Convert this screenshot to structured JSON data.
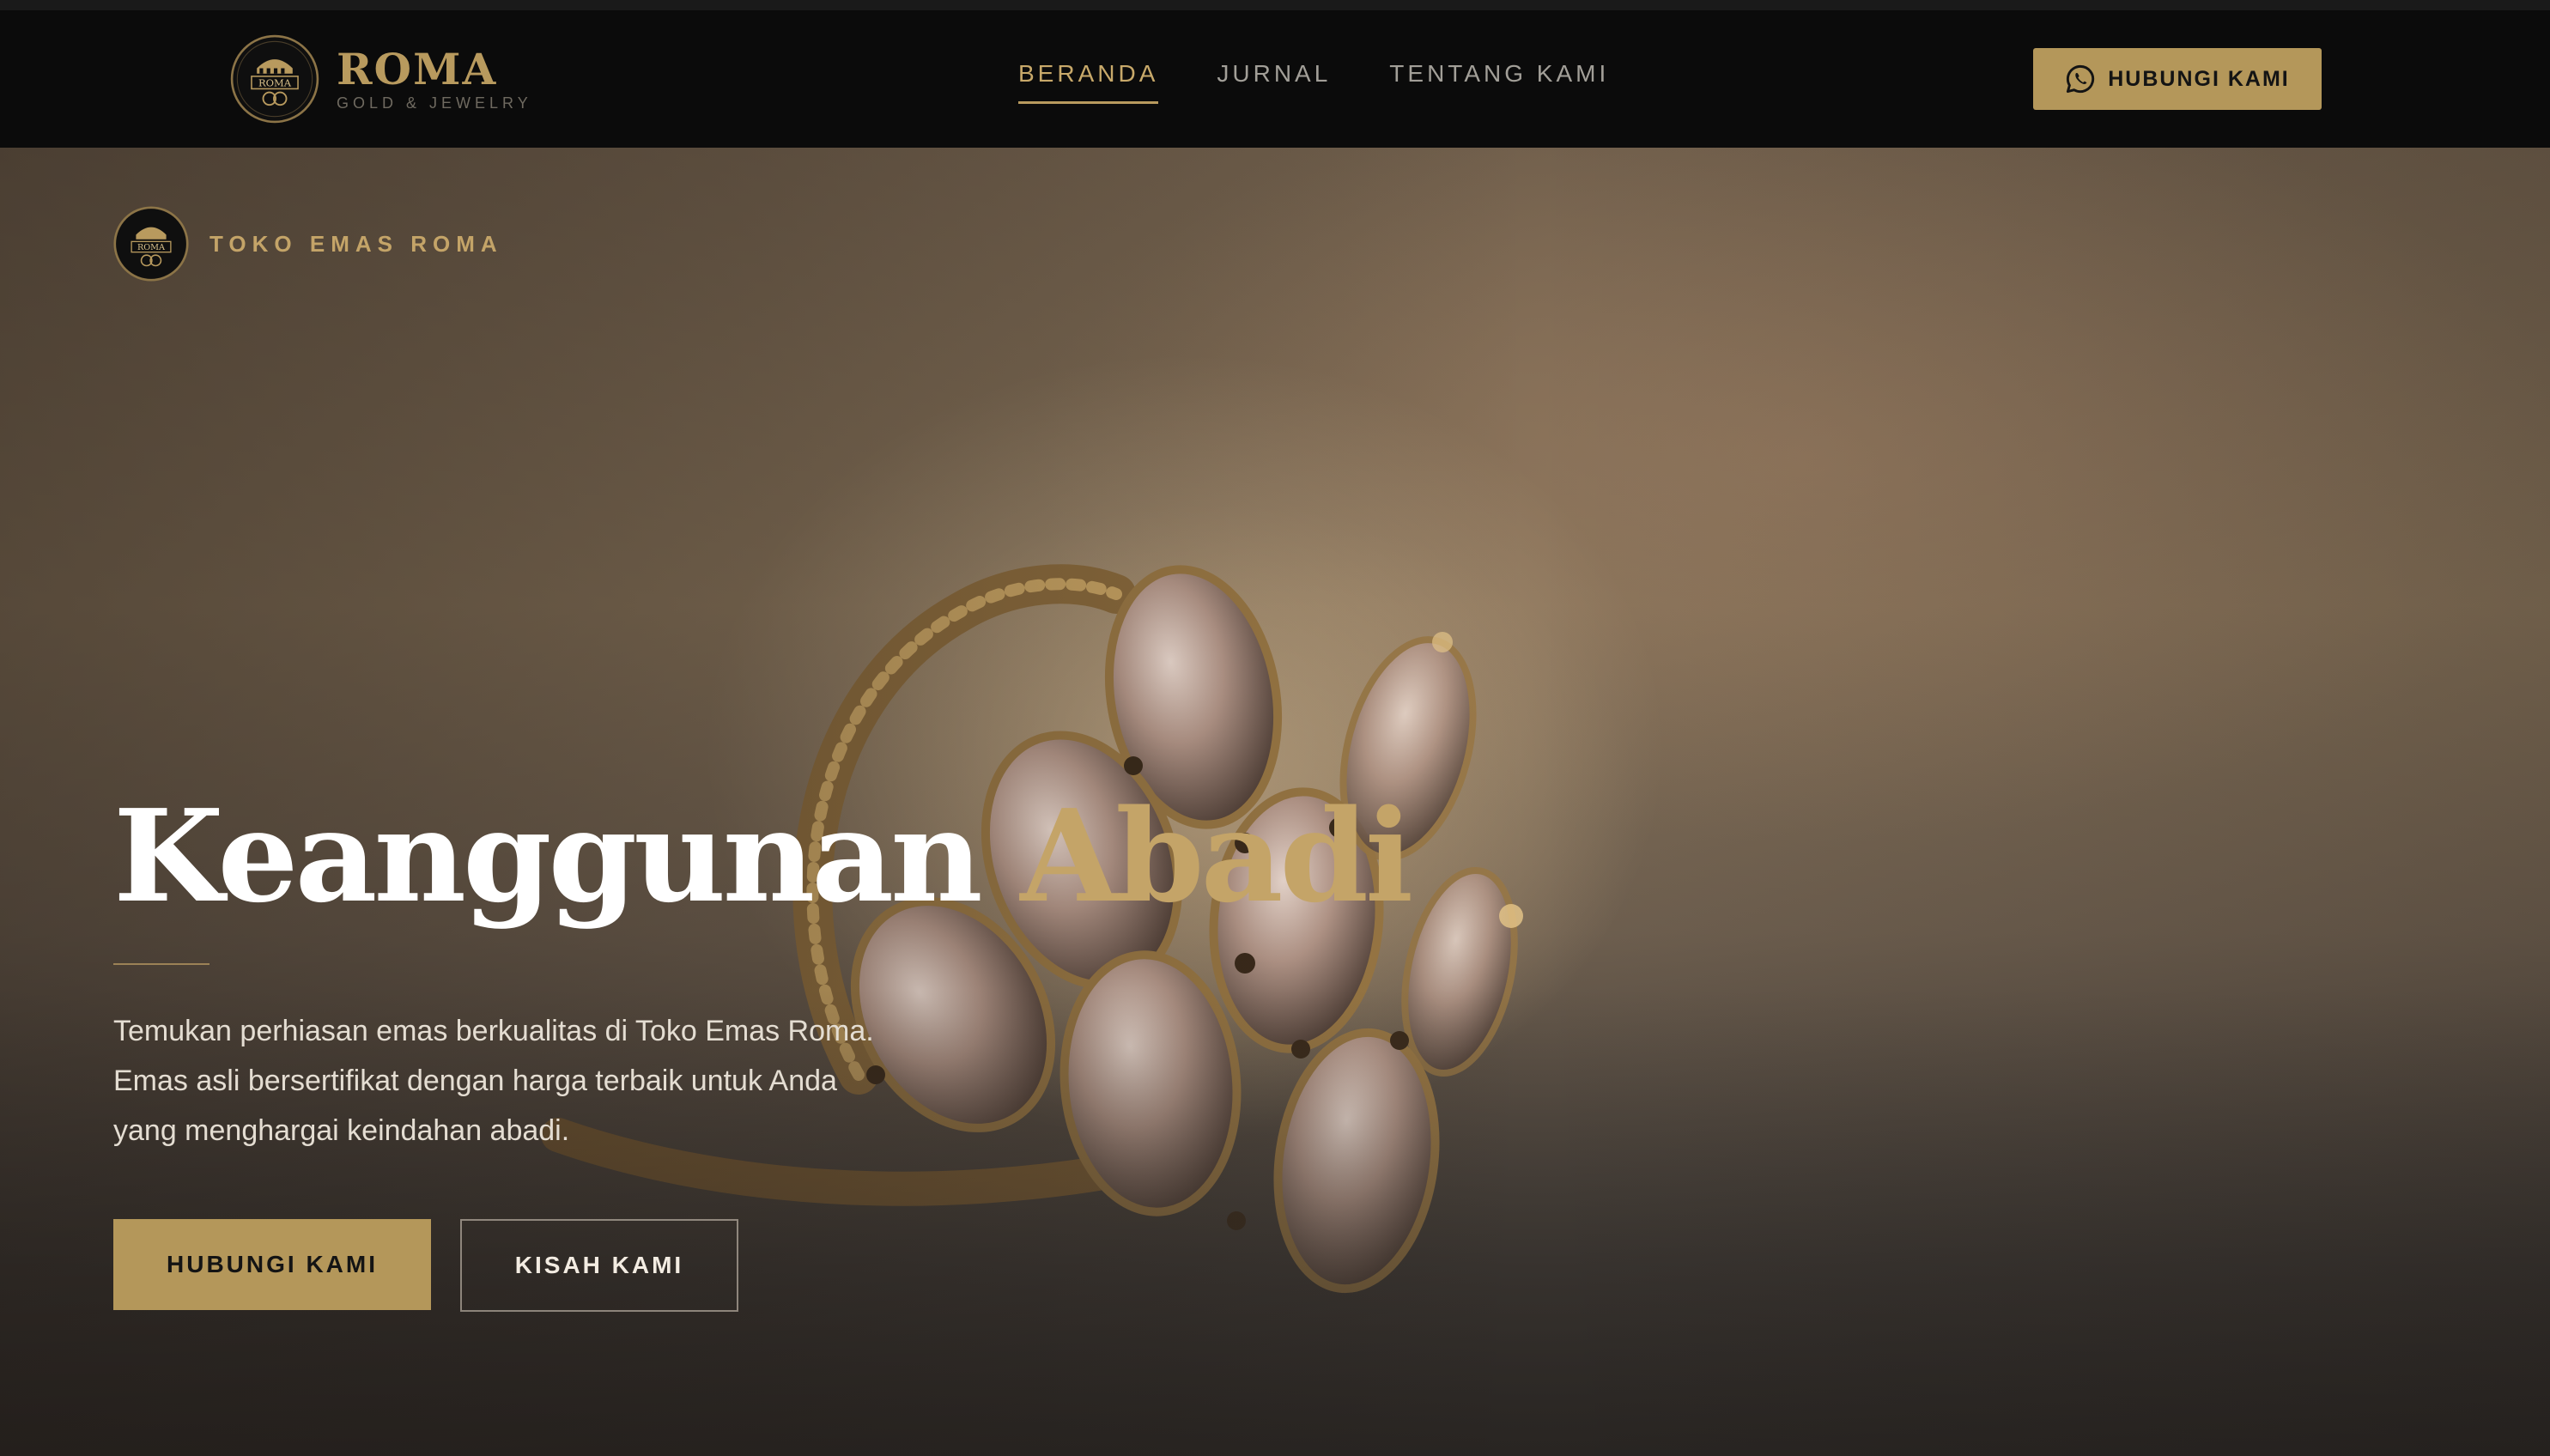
{
  "header": {
    "brand": {
      "name": "ROMA",
      "tagline": "GOLD & JEWELRY",
      "seal_text": "ROMA"
    },
    "nav": [
      {
        "label": "BERANDA",
        "active": true
      },
      {
        "label": "JURNAL",
        "active": false
      },
      {
        "label": "TENTANG KAMI",
        "active": false
      }
    ],
    "cta": {
      "label": "HUBUNGI KAMI",
      "icon": "whatsapp-icon"
    }
  },
  "hero": {
    "eyebrow": {
      "label": "TOKO EMAS ROMA",
      "seal_text": "ROMA"
    },
    "headline": {
      "main": "Keanggunan",
      "accent": "Abadi"
    },
    "description": "Temukan perhiasan emas berkualitas di Toko Emas Roma. Emas asli bersertifikat dengan harga terbaik untuk Anda yang menghargai keindahan abadi.",
    "primary_button": "HUBUNGI KAMI",
    "secondary_button": "KISAH KAMI",
    "background_image": "gold-ring-with-gemstones"
  },
  "colors": {
    "gold": "#b4975a",
    "gold_text": "#c4a468",
    "header_bg": "#0b0b0b",
    "nav_text": "#a29f98"
  }
}
